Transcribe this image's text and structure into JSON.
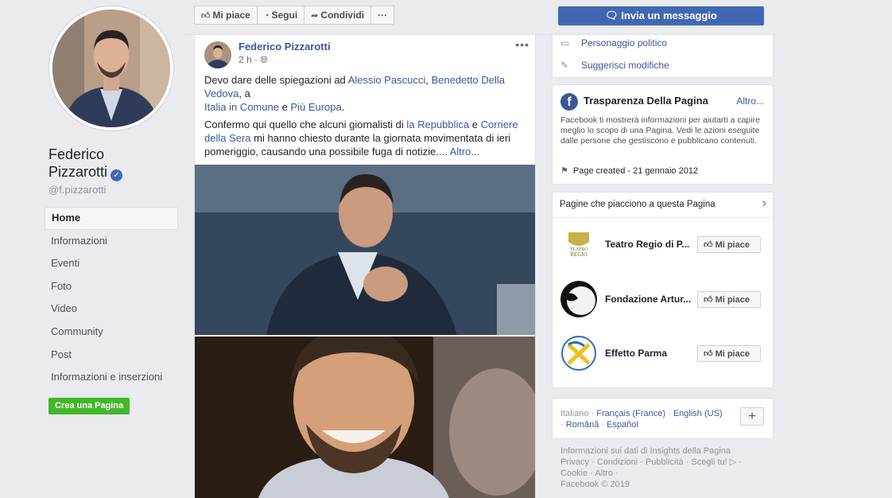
{
  "profile": {
    "name_line1": "Federico",
    "name_line2": "Pizzarotti",
    "handle": "@f.pizzarotti",
    "nav": [
      "Home",
      "Informazioni",
      "Eventi",
      "Foto",
      "Video",
      "Community",
      "Post",
      "Informazioni e inserzioni"
    ],
    "create_page": "Crea una Pagina"
  },
  "actions": {
    "like": "Mi piace",
    "follow": "Segui",
    "share": "Condividi",
    "more": "···"
  },
  "message_button": "Invia un messaggio",
  "post": {
    "author": "Federico Pizzarotti",
    "time": "2 h",
    "more": "•••",
    "p1_a": "Devo dare delle spiegazioni ad ",
    "p1_link1": "Alessio Pascucci",
    "p1_b": ", ",
    "p1_link2": "Benedetto Della Vedova",
    "p1_c": ", a",
    "p1_link3": "Italia in Comune",
    "p1_d": " e ",
    "p1_link4": "Più Europa",
    "p1_e": ".",
    "p2_a": "Confermo qui quello che alcuni giornalisti di ",
    "p2_link1": "la Repubblica",
    "p2_b": " e ",
    "p2_link2": "Corriere della Sera",
    "p2_c": " mi hanno chiesto durante la giornata movimentata di ieri pomeriggio, causando una possibile fuga di notizie.... ",
    "p2_more": "Altro..."
  },
  "about": {
    "category": "Personaggio politico",
    "suggest": "Suggerisci modifiche"
  },
  "transparency": {
    "title": "Trasparenza Della Pagina",
    "more": "Altro...",
    "desc": "Facebook ti mostrerà informazioni per aiutarti a capire meglio lo scopo di una Pagina. Vedi le azioni eseguite dalle persone che gestiscono e pubblicano contenuti.",
    "created": "Page created - 21 gennaio 2012"
  },
  "liked_pages": {
    "title": "Pagine che piacciono a questa Pagina",
    "like_label": "Mi piace",
    "items": [
      {
        "name": "Teatro Regio di P..."
      },
      {
        "name": "Fondazione Artur..."
      },
      {
        "name": "Effetto Parma"
      }
    ]
  },
  "languages": {
    "current": "Italiano",
    "sep": " · ",
    "others": [
      "Français (France)",
      "English (US)",
      "Română",
      "Español"
    ],
    "plus": "+"
  },
  "footer": {
    "line1": "Informazioni sui dati di Insights della Pagina",
    "line2": "Privacy · Condizioni · Pubblicità · Scegli tu! ▷ ·",
    "line3": "Cookie · Altro ·",
    "line4": "Facebook © 2019"
  },
  "colors": {
    "brand": "#4267b2",
    "link": "#385898",
    "create_page": "#42b72a",
    "background": "#e9ebee"
  }
}
